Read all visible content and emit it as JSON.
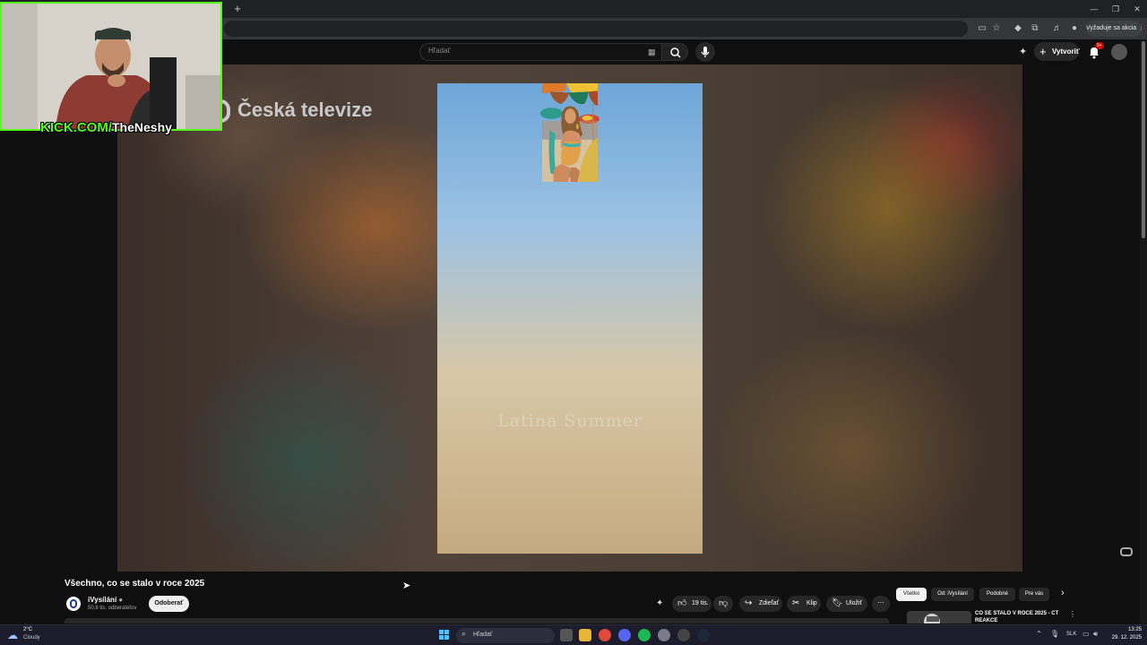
{
  "browser": {
    "new_tab_icon": "plus-icon",
    "window_controls": [
      "minimize-icon",
      "restore-icon",
      "close-icon"
    ],
    "update_label": "Vyžaduje sa akcia"
  },
  "youtube_header": {
    "search_placeholder": "Hľadať",
    "create_label": "Vytvoriť",
    "notifications_badge": "9+"
  },
  "player": {
    "broadcaster_logo": "Česká televize",
    "short_watermark": "Latina Summer"
  },
  "webcam": {
    "domain": "KICK.COM/",
    "streamer": "TheNeshy"
  },
  "video": {
    "title": "Všechno, co se stalo v roce 2025",
    "channel_name": "iVysílání",
    "channel_subscribers": "50,6 tis. odberateľov",
    "subscribe_label": "Odoberať",
    "like_count": "19 tis.",
    "share_label": "Zdieľať",
    "clip_label": "Klip",
    "save_label": "Uložiť"
  },
  "recommendations": {
    "chips": [
      "Všetko",
      "Od: iVysílání",
      "Podobné",
      "Pre vás"
    ],
    "selected_chip": "Všetko",
    "first_title": "CO SE STALO V ROCE 2025 - ČT REAKCE"
  },
  "taskbar": {
    "weather_temp": "2°C",
    "weather_condition": "Cloudy",
    "search_label": "Hľadať",
    "language": "SLK",
    "time": "13:25",
    "date": "29. 12. 2025"
  },
  "colors": {
    "kick_green": "#53fc18",
    "youtube_bg": "#0f0f0f",
    "taskbar_bg": "#1c1c2c"
  }
}
